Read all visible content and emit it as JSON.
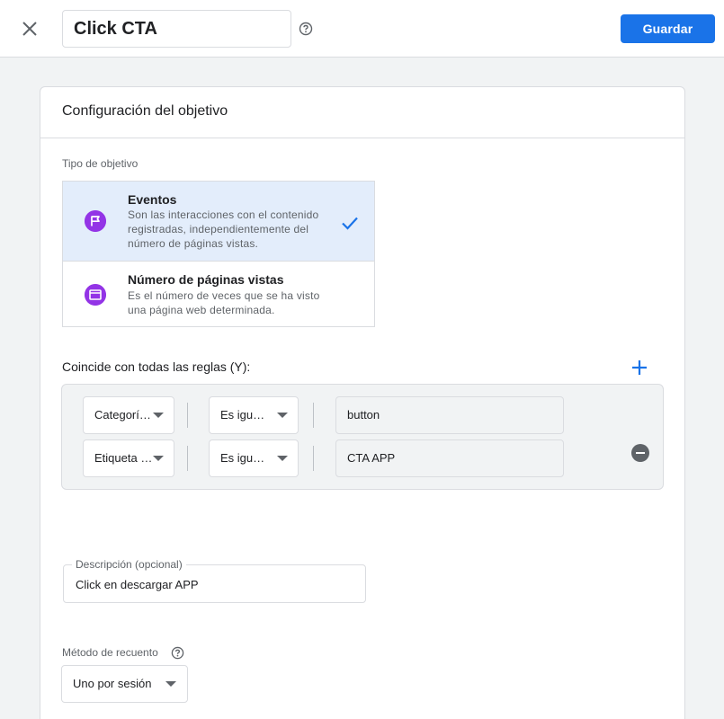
{
  "header": {
    "title": "Click CTA",
    "save_label": "Guardar"
  },
  "card": {
    "title": "Configuración del objetivo"
  },
  "goal_type": {
    "label": "Tipo de objetivo",
    "options": [
      {
        "title": "Eventos",
        "desc_line1": "Son las interacciones con el contenido",
        "desc_line2": "registradas, independientemente del",
        "desc_line3": "número de páginas vistas.",
        "selected": true,
        "icon": "flag-icon"
      },
      {
        "title": "Número de páginas vistas",
        "desc_line1": "Es el número de veces que se ha visto",
        "desc_line2": "una página web determinada.",
        "selected": false,
        "icon": "browser-window-icon"
      }
    ]
  },
  "rules": {
    "label": "Coincide con todas las reglas (Y):",
    "rows": [
      {
        "field": "Categorí…",
        "operator": "Es igu…",
        "value": "button"
      },
      {
        "field": "Etiqueta …",
        "operator": "Es igu…",
        "value": "CTA APP"
      }
    ]
  },
  "description": {
    "label": "Descripción (opcional)",
    "value": "Click en descargar APP"
  },
  "count_method": {
    "label": "Método de recuento",
    "value": "Uno por sesión"
  },
  "colors": {
    "primary": "#1a73e8",
    "selected_bg": "#e3edfb",
    "icon_purple": "#9334e6",
    "page_bg": "#f1f3f4"
  }
}
